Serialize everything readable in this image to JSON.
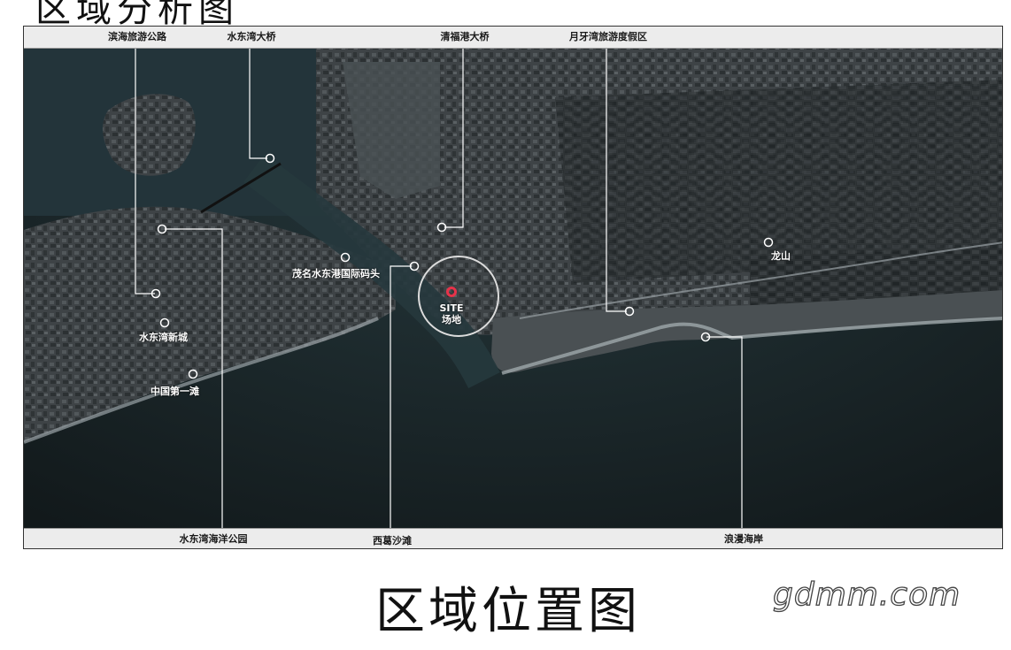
{
  "top_partial_text": "区域分析图",
  "caption": "区域位置图",
  "watermark": "gdmm.com",
  "colors": {
    "land": "#3b4043",
    "sea": "#1d2a2e",
    "site_marker": "#e8334a",
    "leader": "#ffffff"
  },
  "top_labels": [
    "滨海旅游公路",
    "水东湾大桥",
    "清福港大桥",
    "月牙湾旅游度假区"
  ],
  "bottom_labels": [
    "水东湾海洋公园",
    "西葛沙滩",
    "浪漫海岸"
  ],
  "map_labels": [
    "茂名水东港国际码头",
    "水东湾新城",
    "中国第一滩",
    "龙山"
  ],
  "site": {
    "en": "SITE",
    "cn": "场地"
  }
}
